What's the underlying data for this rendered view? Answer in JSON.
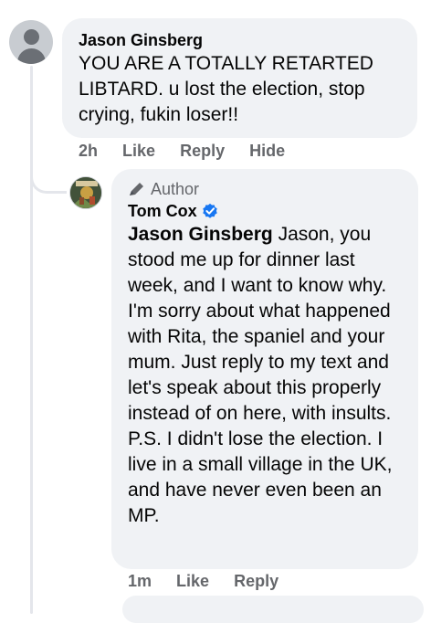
{
  "comment": {
    "author": "Jason Ginsberg",
    "text": "YOU ARE A TOTALLY RETARTED LIBTARD. u lost the election, stop crying, fukin loser!!",
    "time": "2h",
    "actions": {
      "like": "Like",
      "reply": "Reply",
      "hide": "Hide"
    }
  },
  "reply": {
    "badge": "Author",
    "author": "Tom Cox",
    "mention": "Jason Ginsberg",
    "text": "Jason, you stood me up for dinner last week, and I want to know why. I'm sorry about what happened with Rita, the spaniel and your mum. Just reply to my text and let's speak about this properly instead of on here, with insults. P.S. I didn't lose the election. I live in a small village in the UK, and have never even been an MP.",
    "time": "1m",
    "actions": {
      "like": "Like",
      "reply": "Reply"
    }
  },
  "colors": {
    "bubble": "#f0f2f5",
    "meta_text": "#65676b",
    "verified": "#1877f2"
  },
  "icons": {
    "author_badge": "pen-icon",
    "verified": "verified-badge-icon",
    "default_avatar": "default-avatar-icon"
  }
}
